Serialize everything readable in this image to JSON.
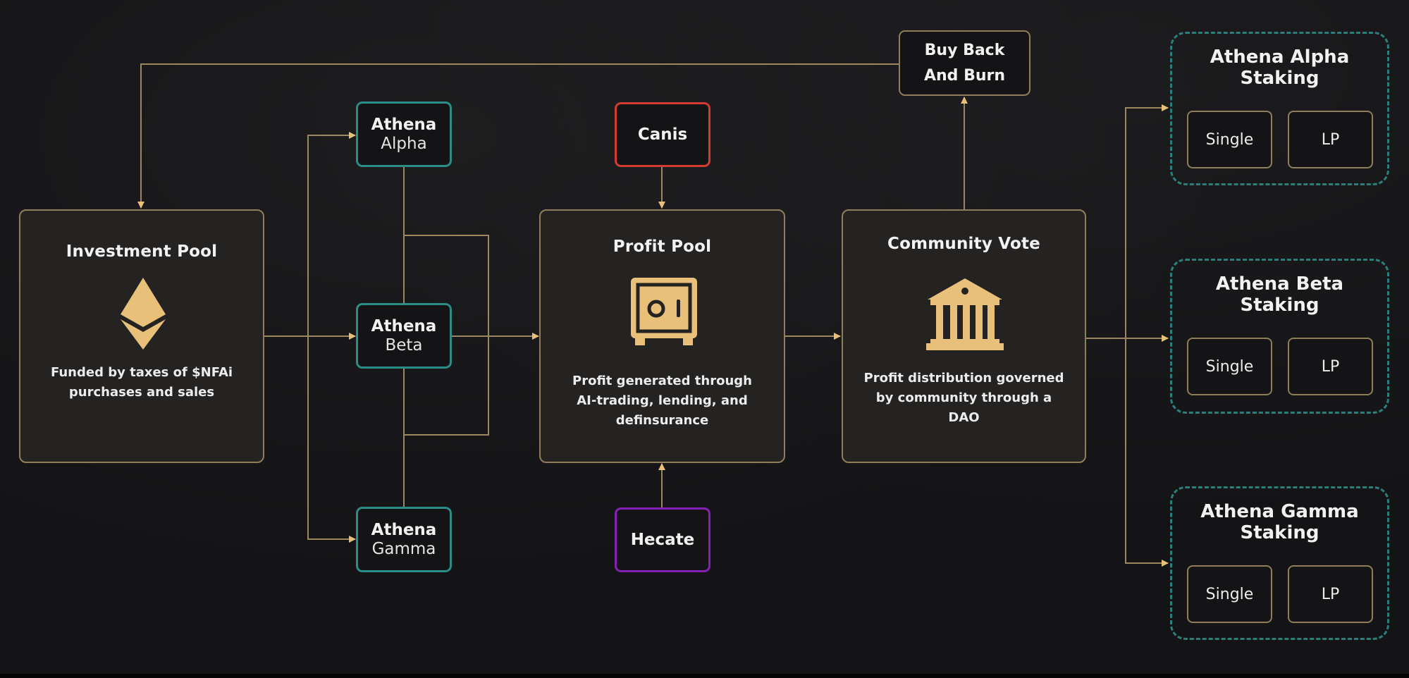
{
  "colors": {
    "gold": "#E9C07A",
    "teal": "#2A8D86",
    "canis_red": "#D23A32",
    "hecate_purple": "#8420B4",
    "box_bg": "#252321",
    "page_bg": "#141416"
  },
  "investment_pool": {
    "title": "Investment Pool",
    "icon": "ethereum-icon",
    "desc_line1": "Funded by taxes of $NFAi",
    "desc_line2": "purchases and sales"
  },
  "athena_agents": [
    {
      "line1": "Athena",
      "line2": "Alpha"
    },
    {
      "line1": "Athena",
      "line2": "Beta"
    },
    {
      "line1": "Athena",
      "line2": "Gamma"
    }
  ],
  "canis": {
    "label": "Canis"
  },
  "hecate": {
    "label": "Hecate"
  },
  "profit_pool": {
    "title": "Profit Pool",
    "icon": "safe-icon",
    "desc_line1": "Profit generated through",
    "desc_line2": "AI-trading, lending, and",
    "desc_line3": "definsurance"
  },
  "community_vote": {
    "title": "Community Vote",
    "icon": "bank-icon",
    "desc_line1": "Profit distribution governed",
    "desc_line2": "by community through a",
    "desc_line3": "DAO"
  },
  "buy_back": {
    "line1": "Buy Back",
    "line2": "And Burn"
  },
  "staking": [
    {
      "line1": "Athena Alpha",
      "line2": "Staking",
      "options": [
        "Single",
        "LP"
      ]
    },
    {
      "line1": "Athena Beta",
      "line2": "Staking",
      "options": [
        "Single",
        "LP"
      ]
    },
    {
      "line1": "Athena Gamma",
      "line2": "Staking",
      "options": [
        "Single",
        "LP"
      ]
    }
  ]
}
